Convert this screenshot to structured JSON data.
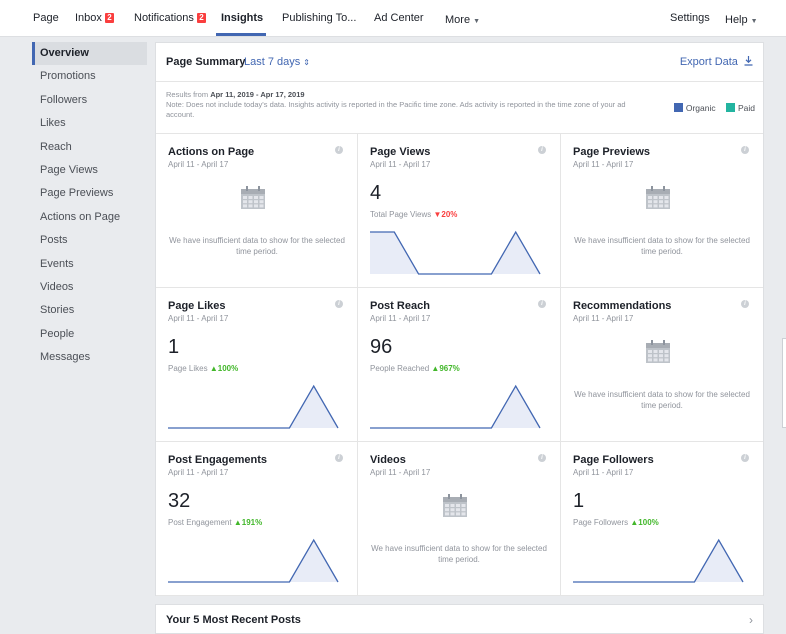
{
  "nav": {
    "page": "Page",
    "inbox": "Inbox",
    "inbox_badge": "2",
    "notifications": "Notifications",
    "notifications_badge": "2",
    "insights": "Insights",
    "publishing": "Publishing To...",
    "ad_center": "Ad Center",
    "more": "More",
    "settings": "Settings",
    "help": "Help"
  },
  "sidebar": {
    "items": [
      {
        "label": "Overview"
      },
      {
        "label": "Promotions"
      },
      {
        "label": "Followers"
      },
      {
        "label": "Likes"
      },
      {
        "label": "Reach"
      },
      {
        "label": "Page Views"
      },
      {
        "label": "Page Previews"
      },
      {
        "label": "Actions on Page"
      },
      {
        "label": "Posts"
      },
      {
        "label": "Events"
      },
      {
        "label": "Videos"
      },
      {
        "label": "Stories"
      },
      {
        "label": "People"
      },
      {
        "label": "Messages"
      }
    ]
  },
  "summary": {
    "title": "Page Summary",
    "range": "Last 7 days",
    "export": "Export Data",
    "results_prefix": "Results from ",
    "results_range": "Apr 11, 2019 - Apr 17, 2019",
    "note": "Note: Does not include today's data. Insights activity is reported in the Pacific time zone. Ads activity is reported in the time zone of your ad account.",
    "legend_organic": "Organic",
    "legend_paid": "Paid"
  },
  "colors": {
    "accent": "#4267b2",
    "organic": "#4267b2",
    "paid": "#23b4a0",
    "up": "#42b72a",
    "down": "#fa3e3e"
  },
  "insufficient": "We have insufficient data to show for the selected time period.",
  "cards": [
    {
      "title": "Actions on Page",
      "date": "April 11 - April 17"
    },
    {
      "title": "Page Views",
      "date": "April 11 - April 17",
      "value": "4",
      "sub": "Total Page Views",
      "change": "20%",
      "direction": "down",
      "series": [
        1,
        1,
        0,
        0,
        0,
        0,
        1,
        0
      ]
    },
    {
      "title": "Page Previews",
      "date": "April 11 - April 17"
    },
    {
      "title": "Page Likes",
      "date": "April 11 - April 17",
      "value": "1",
      "sub": "Page Likes",
      "change": "100%",
      "direction": "up",
      "series": [
        0,
        0,
        0,
        0,
        0,
        0,
        1,
        0
      ]
    },
    {
      "title": "Post Reach",
      "date": "April 11 - April 17",
      "value": "96",
      "sub": "People Reached",
      "change": "967%",
      "direction": "up",
      "series": [
        0,
        0,
        0,
        0,
        0,
        0,
        1,
        0
      ]
    },
    {
      "title": "Recommendations",
      "date": "April 11 - April 17"
    },
    {
      "title": "Post Engagements",
      "date": "April 11 - April 17",
      "value": "32",
      "sub": "Post Engagement",
      "change": "191%",
      "direction": "up",
      "series": [
        0,
        0,
        0,
        0,
        0,
        0,
        1,
        0
      ]
    },
    {
      "title": "Videos",
      "date": "April 11 - April 17"
    },
    {
      "title": "Page Followers",
      "date": "April 11 - April 17",
      "value": "1",
      "sub": "Page Followers",
      "change": "100%",
      "direction": "up",
      "series": [
        0,
        0,
        0,
        0,
        0,
        0,
        1,
        0
      ]
    }
  ],
  "recent": {
    "title": "Your 5 Most Recent Posts"
  }
}
